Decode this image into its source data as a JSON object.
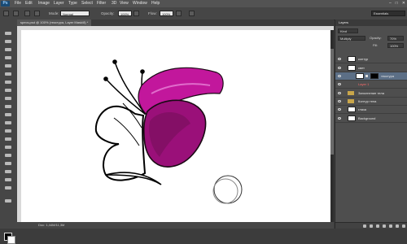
{
  "app": {
    "logo": "Ps"
  },
  "menu": [
    "File",
    "Edit",
    "Image",
    "Layer",
    "Type",
    "Select",
    "Filter",
    "3D",
    "View",
    "Window",
    "Help"
  ],
  "options": {
    "mode_label": "Mode:",
    "mode_value": "Normal",
    "opacity_label": "Opacity:",
    "opacity_value": "100%",
    "flow_label": "Flow:",
    "flow_value": "100%"
  },
  "workspace": "Essentials",
  "document": {
    "tab_title": "specs.psd @ 100% (текстура, Layer Mask/8) *",
    "status": "Doc: 1,44M/11,3M"
  },
  "layers_panel": {
    "tab_label": "Layers",
    "kind_label": "Kind",
    "blend_mode": "Multiply",
    "opacity_label": "Opacity:",
    "opacity_value": "70%",
    "fill_label": "Fill:",
    "fill_value": "100%",
    "layers": [
      {
        "name": "контур",
        "kind": "layer"
      },
      {
        "name": "свет",
        "kind": "layer"
      },
      {
        "name": "текстура",
        "kind": "masked",
        "selected": true
      },
      {
        "name": "Layer 1",
        "kind": "layer",
        "red": true
      },
      {
        "name": "Заполнение тела",
        "kind": "folder"
      },
      {
        "name": "Контур тела",
        "kind": "folder"
      },
      {
        "name": "глаза",
        "kind": "layer"
      },
      {
        "name": "Background",
        "kind": "background"
      }
    ]
  },
  "colors": {
    "accent": "#c2179c",
    "shadow": "#7a0f5e"
  }
}
